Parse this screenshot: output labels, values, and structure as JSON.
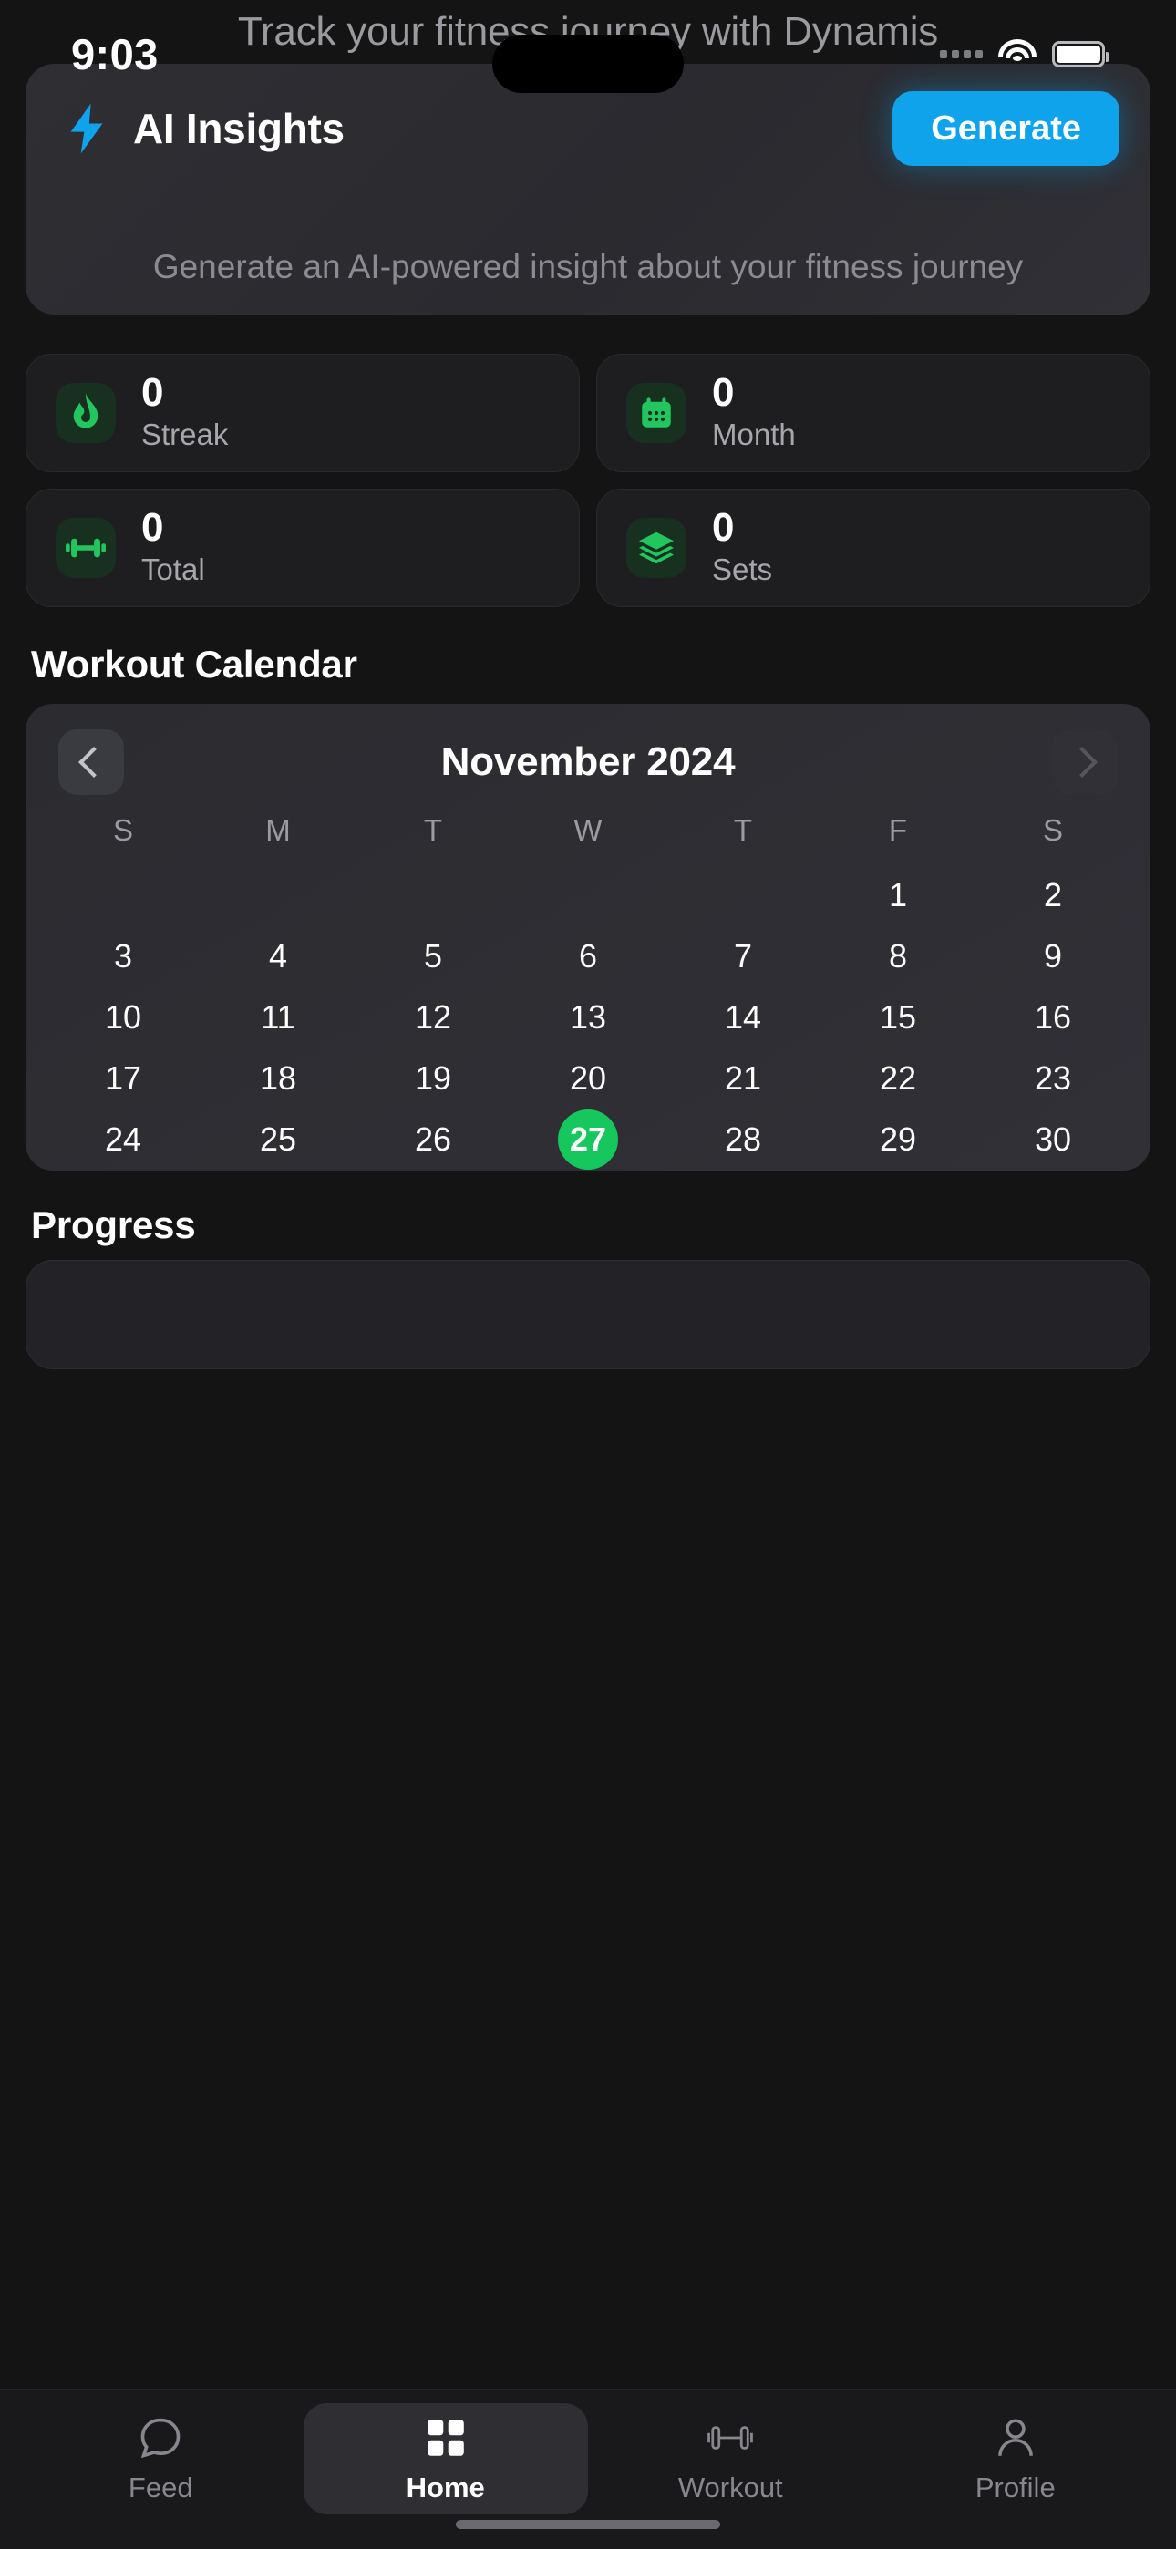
{
  "app": {
    "background_title": "Track your fitness journey with Dynamis",
    "accent_blue": "#0fa3ec",
    "accent_green": "#16c75e"
  },
  "status_bar": {
    "time": "9:03",
    "cellular_icon": "cellular-dots-icon",
    "wifi_icon": "wifi-icon",
    "battery_icon": "battery-icon"
  },
  "ai_insights": {
    "icon": "lightning-bolt-icon",
    "title": "AI Insights",
    "generate_label": "Generate",
    "description": "Generate an AI-powered insight about your fitness journey"
  },
  "stats": [
    {
      "icon": "flame-icon",
      "value": "0",
      "label": "Streak"
    },
    {
      "icon": "calendar-icon",
      "value": "0",
      "label": "Month"
    },
    {
      "icon": "dumbbell-icon",
      "value": "0",
      "label": "Total"
    },
    {
      "icon": "layers-icon",
      "value": "0",
      "label": "Sets"
    }
  ],
  "calendar_section": {
    "title": "Workout Calendar",
    "month_label": "November 2024",
    "prev_icon": "chevron-left-icon",
    "next_icon": "chevron-right-icon",
    "day_headers": [
      "S",
      "M",
      "T",
      "W",
      "T",
      "F",
      "S"
    ],
    "leading_blanks": 5,
    "days": [
      1,
      2,
      3,
      4,
      5,
      6,
      7,
      8,
      9,
      10,
      11,
      12,
      13,
      14,
      15,
      16,
      17,
      18,
      19,
      20,
      21,
      22,
      23,
      24,
      25,
      26,
      27,
      28,
      29,
      30
    ],
    "selected_day": 27
  },
  "progress_section": {
    "title": "Progress"
  },
  "tabbar": {
    "items": [
      {
        "icon": "chat-bubble-icon",
        "label": "Feed",
        "active": false
      },
      {
        "icon": "grid-icon",
        "label": "Home",
        "active": true
      },
      {
        "icon": "dumbbell-icon",
        "label": "Workout",
        "active": false
      },
      {
        "icon": "person-icon",
        "label": "Profile",
        "active": false
      }
    ]
  }
}
